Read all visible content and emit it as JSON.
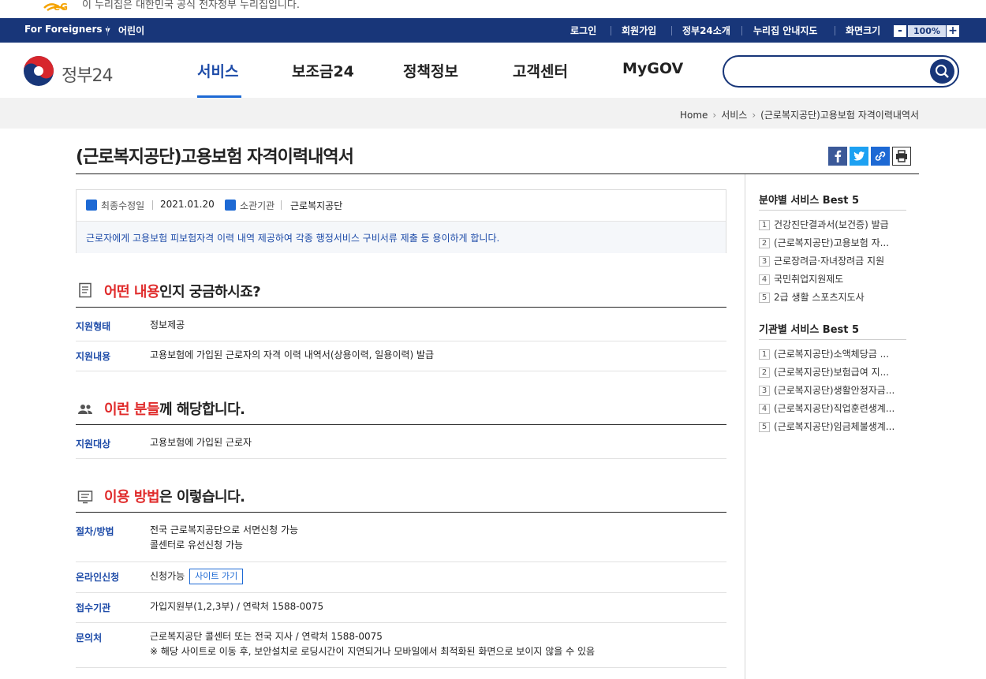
{
  "banner": {
    "text": "이 누리집은 대한민국 공식 전자정부 누리집입니다."
  },
  "topbar": {
    "for_foreigners": "For Foreigners",
    "kids": "어린이",
    "login": "로그인",
    "signup": "회원가입",
    "about": "정부24소개",
    "sitemap": "누리집 안내지도",
    "screen_size": "화면크기",
    "zoom_minus": "-",
    "zoom_value": "100%",
    "zoom_plus": "+"
  },
  "header": {
    "brand": "정부24",
    "nav": [
      "서비스",
      "보조금24",
      "정책정보",
      "고객센터",
      "MyGOV"
    ],
    "search_placeholder": ""
  },
  "breadcrumb": [
    "Home",
    "서비스",
    "(근로복지공단)고용보험 자격이력내역서"
  ],
  "page": {
    "title": "(근로복지공단)고용보험 자격이력내역서",
    "meta": {
      "updated_label": "최종수정일",
      "updated_value": "2021.01.20",
      "agency_label": "소관기관",
      "agency_value": "근로복지공단"
    },
    "summary": "근로자에게 고용보험 피보험자격 이력 내역 제공하여 각종 행정서비스 구비서류 제출 등 용이하게 합니다."
  },
  "sections": {
    "content": {
      "title_red": "어떤 내용",
      "title_rest": "인지 궁금하시죠?",
      "rows": [
        {
          "label": "지원형태",
          "value": "정보제공"
        },
        {
          "label": "지원내용",
          "value": "고용보험에 가입된 근로자의 자격 이력 내역서(상용이력, 일용이력) 발급"
        }
      ]
    },
    "target": {
      "title_red": "이런 분들",
      "title_rest": "께 해당합니다.",
      "rows": [
        {
          "label": "지원대상",
          "value": "고용보험에 가입된 근로자"
        }
      ]
    },
    "howto": {
      "title_red": "이용 방법",
      "title_rest": "은 이렇습니다.",
      "procedure_label": "절차/방법",
      "procedure_line1": "전국 근로복지공단으로 서면신청 가능",
      "procedure_line2": "콜센터로 유선신청 가능",
      "online_label": "온라인신청",
      "online_value": "신청가능",
      "site_button": "사이트 가기",
      "reception_label": "접수기관",
      "reception_value": "가입지원부(1,2,3부) / 연락처 1588-0075",
      "contact_label": "문의처",
      "contact_line1": "근로복지공단 콜센터 또는 전국 지사 / 연락처 1588-0075",
      "contact_line2": "※ 해당 사이트로 이동 후, 보안설치로 로딩시간이 지연되거나 모바일에서 최적화된 화면으로 보이지 않을 수 있음"
    }
  },
  "sidebar": {
    "field_title": "분야별 서비스 Best 5",
    "field_items": [
      "건강진단결과서(보건증) 발급",
      "(근로복지공단)고용보험 자...",
      "근로장려금·자녀장려금 지원",
      "국민취업지원제도",
      "2급 생활 스포츠지도사"
    ],
    "agency_title": "기관별 서비스 Best 5",
    "agency_items": [
      "(근로복지공단)소액체당금 ...",
      "(근로복지공단)보험급여 지...",
      "(근로복지공단)생활안정자금...",
      "(근로복지공단)직업훈련생계...",
      "(근로복지공단)임금체불생계..."
    ],
    "numbers": [
      "1",
      "2",
      "3",
      "4",
      "5"
    ]
  }
}
